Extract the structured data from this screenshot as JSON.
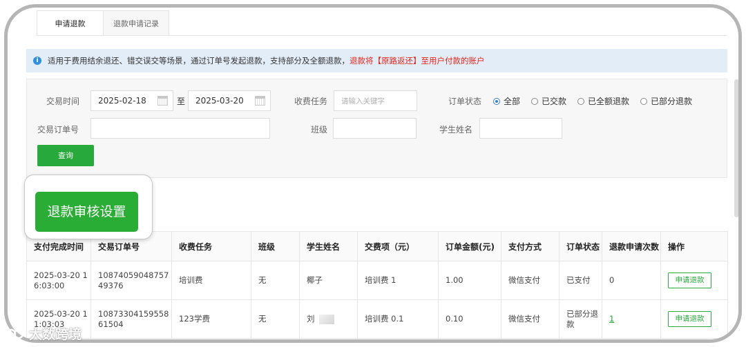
{
  "tabs": [
    {
      "label": "申请退款"
    },
    {
      "label": "退款申请记录"
    }
  ],
  "notice": {
    "text": "适用于费用结余退还、错交误交等场景，通过订单号发起退款，支持部分及全额退款，",
    "red_text": "退款将【原路返还】至用户付款的账户"
  },
  "filters": {
    "trade_time_label": "交易时间",
    "date_from": "2025-02-18",
    "date_sep": "至",
    "date_to": "2025-03-20",
    "fee_task_label": "收费任务",
    "fee_task_placeholder": "请输入关键字",
    "order_status_label": "订单状态",
    "status_options": [
      "全部",
      "已交款",
      "已全额退款",
      "已部分退款"
    ],
    "order_no_label": "交易订单号",
    "class_label": "班级",
    "student_label": "学生姓名",
    "query_button": "查询"
  },
  "callout": {
    "label": "退款审核设置"
  },
  "table": {
    "headers": [
      "支付完成时间",
      "交易订单号",
      "收费任务",
      "班级",
      "学生姓名",
      "交费项（元）",
      "订单金额(元)",
      "支付方式",
      "订单状态",
      "退款申请次数",
      "操作"
    ],
    "rows": [
      {
        "time": "2025-03-20 16:03:00",
        "order_no": "1087405904875749376",
        "task": "培训费",
        "class": "无",
        "student": "椰子",
        "item": "培训费 1",
        "amount": "1.00",
        "pay": "微信支付",
        "status": "已支付",
        "count": "0",
        "action": "申请退款"
      },
      {
        "time": "2025-03-20 11:03:03",
        "order_no": "1087330415955861504",
        "task": "123学费",
        "class": "无",
        "student": "刘",
        "item": "培训费 0.1",
        "amount": "0.10",
        "pay": "微信支付",
        "status": "已部分退款",
        "count": "1",
        "action": "申请退款"
      }
    ]
  },
  "watermark": {
    "text": "大数跨境"
  },
  "colors": {
    "green": "#27a93b",
    "red": "#e4231a",
    "notice_bg": "#e3edf8",
    "frame": "#b5b5b5"
  }
}
